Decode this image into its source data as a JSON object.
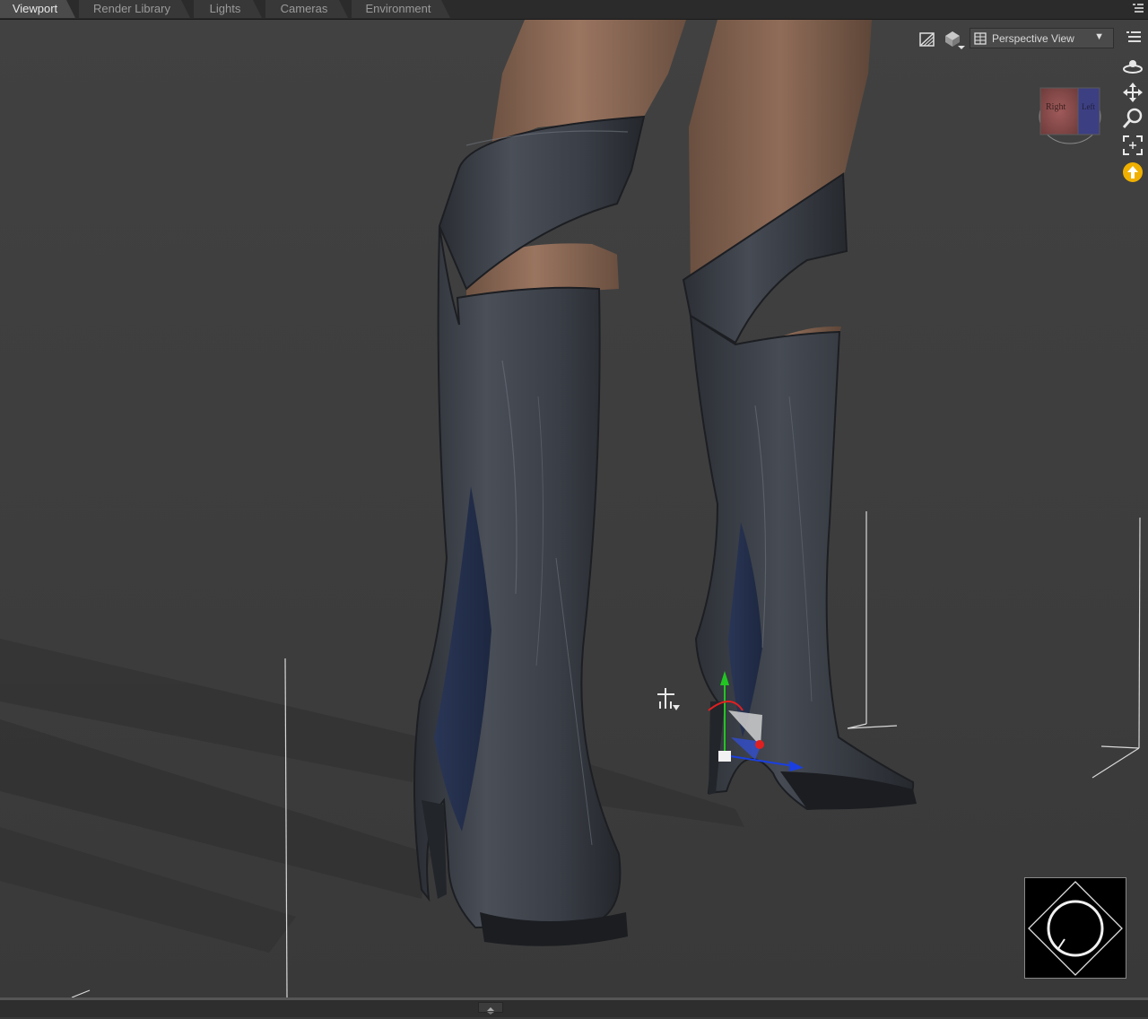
{
  "tabs": [
    {
      "label": "Viewport",
      "active": true
    },
    {
      "label": "Render Library",
      "active": false
    },
    {
      "label": "Lights",
      "active": false
    },
    {
      "label": "Cameras",
      "active": false
    },
    {
      "label": "Environment",
      "active": false
    }
  ],
  "viewport": {
    "view_select": {
      "selected": "Perspective View"
    },
    "header_icons": [
      "draw-style-icon",
      "display-options-icon",
      "grid-view-icon"
    ],
    "nav_icons": [
      "orbit-icon",
      "pan-icon",
      "zoom-icon",
      "frame-icon",
      "aim-icon"
    ],
    "view_cube_faces": [
      "Right",
      "Left"
    ],
    "colors": {
      "background": "#3e3e3e",
      "boot_leather": "#2b2f36",
      "boot_panel": "#2c3a5a",
      "skin": "#8a6a55",
      "axis_y": "#22c422",
      "axis_x": "#e02020",
      "axis_z": "#1a3fe0",
      "accent_yellow": "#f0b000"
    }
  }
}
